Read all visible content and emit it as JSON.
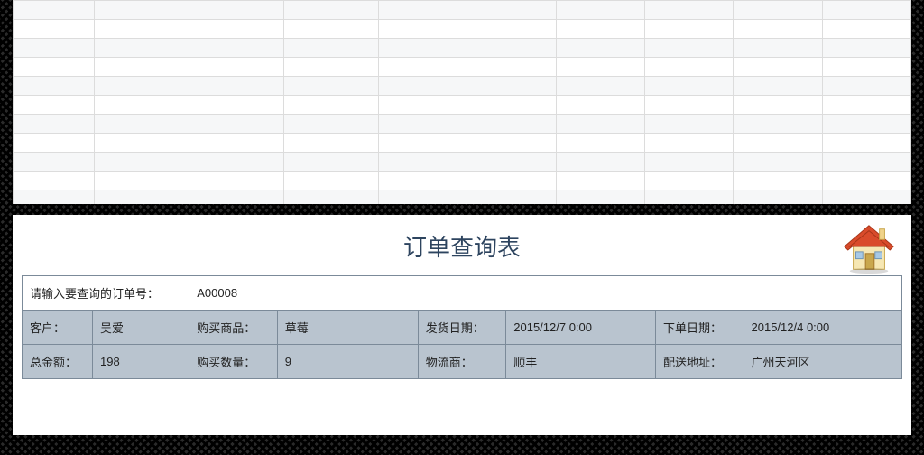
{
  "title": "订单查询表",
  "search": {
    "label": "请输入要查询的订单号：",
    "value": "A00008"
  },
  "fields": {
    "customer_label": "客户：",
    "customer_value": "吴爱",
    "product_label": "购买商品：",
    "product_value": "草莓",
    "ship_date_label": "发货日期：",
    "ship_date_value": "2015/12/7 0:00",
    "order_date_label": "下单日期：",
    "order_date_value": "2015/12/4 0:00",
    "total_label": "总金额：",
    "total_value": "198",
    "qty_label": "购买数量：",
    "qty_value": "9",
    "logistics_label": "物流商：",
    "logistics_value": "顺丰",
    "address_label": "配送地址：",
    "address_value": "广州天河区"
  },
  "icons": {
    "home": "home-icon"
  }
}
